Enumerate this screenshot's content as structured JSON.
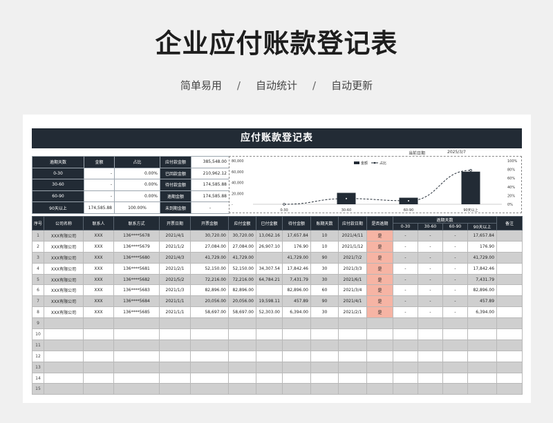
{
  "header": {
    "title": "企业应付账款登记表",
    "features": [
      "简单易用",
      "自动统计",
      "自动更新"
    ],
    "separator": "/"
  },
  "sheet": {
    "banner": "应付账款登记表",
    "date_label": "当前日期",
    "date_value": "2025/3/7"
  },
  "summary": {
    "left_headers": [
      "逾期天数",
      "金额",
      "占比"
    ],
    "left_rows": [
      [
        "0-30",
        "-",
        "0.00%"
      ],
      [
        "30-60",
        "-",
        "0.00%"
      ],
      [
        "60-90",
        "-",
        "0.00%"
      ],
      [
        "90天以上",
        "174,585.88",
        "100.00%"
      ]
    ],
    "right_rows": [
      [
        "应付款金额",
        "385,548.00"
      ],
      [
        "已回款金额",
        "210,962.12"
      ],
      [
        "待付款金额",
        "174,585.88"
      ],
      [
        "逾期金额",
        "174,585.88"
      ],
      [
        "未到期金额",
        "-"
      ]
    ]
  },
  "chart_data": {
    "type": "bar",
    "categories": [
      "0-30",
      "30-60",
      "60-90",
      "90天以上"
    ],
    "series": [
      {
        "name": "金额",
        "type": "bar",
        "values": [
          0,
          21000,
          12000,
          60000
        ]
      },
      {
        "name": "占比",
        "type": "line",
        "values": [
          0,
          0.13,
          0.08,
          0.78
        ]
      }
    ],
    "legend": [
      "金额",
      "占比"
    ],
    "legend_position": "top",
    "y_ticks": [
      "80,000",
      "60,000",
      "40,000",
      "20,000",
      "-"
    ],
    "y2_ticks": [
      "100%",
      "80%",
      "60%",
      "40%",
      "20%",
      "0%"
    ],
    "ylim": [
      0,
      80000
    ],
    "y2lim": [
      0,
      1.0
    ],
    "colors": {
      "bar": "#222b35",
      "line": "#222b35"
    }
  },
  "table": {
    "headers": [
      "序号",
      "公司名称",
      "联系人",
      "联系方式",
      "开票日期",
      "开票金额",
      "应付金额",
      "已付金额",
      "待付金额",
      "账期天数",
      "应付款日期",
      "是否逾期",
      "逾期天数",
      "备注"
    ],
    "sub_headers": [
      "0-30",
      "30-60",
      "60-90",
      "90天以上"
    ],
    "rows": [
      [
        "1",
        "XXX有限公司",
        "XXX",
        "136****5678",
        "2021/4/1",
        "30,720.00",
        "30,720.00",
        "13,062.16",
        "17,657.84",
        "10",
        "2021/4/11",
        "是",
        "-",
        "-",
        "-",
        "17,657.84",
        ""
      ],
      [
        "2",
        "XXX有限公司",
        "XXX",
        "136****5679",
        "2021/1/2",
        "27,084.00",
        "27,084.00",
        "26,907.10",
        "176.90",
        "10",
        "2021/1/12",
        "是",
        "-",
        "-",
        "-",
        "176.90",
        ""
      ],
      [
        "3",
        "XXX有限公司",
        "XXX",
        "136****5680",
        "2021/4/3",
        "41,729.00",
        "41,729.00",
        "",
        "41,729.00",
        "90",
        "2021/7/2",
        "是",
        "-",
        "-",
        "-",
        "41,729.00",
        ""
      ],
      [
        "4",
        "XXX有限公司",
        "XXX",
        "136****5681",
        "2021/2/1",
        "52,150.00",
        "52,150.00",
        "34,307.54",
        "17,842.46",
        "30",
        "2021/3/3",
        "是",
        "-",
        "-",
        "-",
        "17,842.46",
        ""
      ],
      [
        "5",
        "XXX有限公司",
        "XXX",
        "136****5682",
        "2021/5/2",
        "72,216.00",
        "72,216.00",
        "64,784.21",
        "7,431.79",
        "30",
        "2021/6/1",
        "是",
        "-",
        "-",
        "-",
        "7,431.79",
        ""
      ],
      [
        "6",
        "XXX有限公司",
        "XXX",
        "136****5683",
        "2021/1/3",
        "82,896.00",
        "82,896.00",
        "",
        "82,896.00",
        "60",
        "2021/3/4",
        "是",
        "-",
        "-",
        "-",
        "82,896.00",
        ""
      ],
      [
        "7",
        "XXX有限公司",
        "XXX",
        "136****5684",
        "2021/1/1",
        "20,056.00",
        "20,056.00",
        "19,598.11",
        "457.89",
        "90",
        "2021/4/1",
        "是",
        "-",
        "-",
        "-",
        "457.89",
        ""
      ],
      [
        "8",
        "XXX有限公司",
        "XXX",
        "136****5685",
        "2021/1/1",
        "58,697.00",
        "58,697.00",
        "52,303.00",
        "6,394.00",
        "30",
        "2021/2/1",
        "是",
        "-",
        "-",
        "-",
        "6,394.00",
        ""
      ]
    ],
    "empty_rows": [
      "9",
      "10",
      "11",
      "12",
      "13",
      "14",
      "15"
    ]
  }
}
